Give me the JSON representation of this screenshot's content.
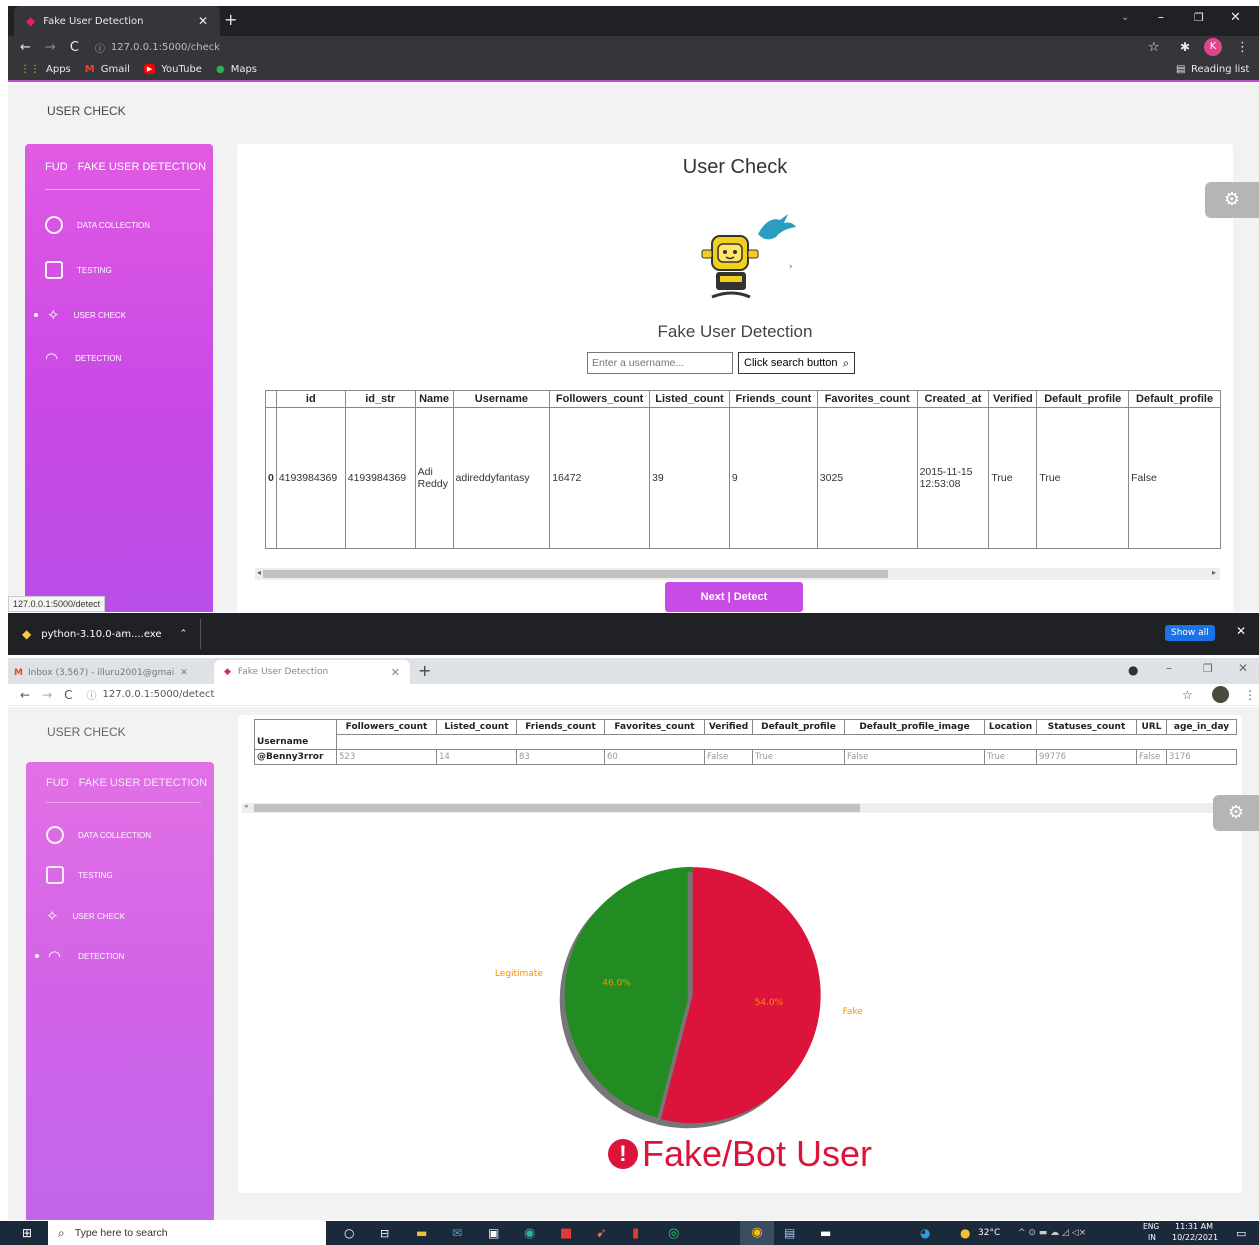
{
  "browser_top": {
    "tab_title": "Fake User Detection",
    "url": "127.0.0.1:5000/check",
    "bookmarks": [
      "Apps",
      "Gmail",
      "YouTube",
      "Maps"
    ],
    "reading_list": "Reading list",
    "profile_initial": "K"
  },
  "page_check": {
    "header": "USER CHECK",
    "sidebar": {
      "brand_short": "FUD",
      "brand_full": "FAKE USER DETECTION",
      "items": [
        "DATA COLLECTION",
        "TESTING",
        "USER CHECK",
        "DETECTION"
      ],
      "active": "USER CHECK"
    },
    "title": "User Check",
    "subtitle": "Fake User Detection",
    "search_placeholder": "Enter a username...",
    "search_button": "Click search button",
    "table": {
      "columns": [
        "",
        "id",
        "id_str",
        "Name",
        "Username",
        "Followers_count",
        "Listed_count",
        "Friends_count",
        "Favorites_count",
        "Created_at",
        "Verified",
        "Default_profile",
        "Default_profile"
      ],
      "row": [
        "0",
        "4193984369",
        "4193984369",
        "Adi Reddy",
        "adireddyfantasy",
        "16472",
        "39",
        "9",
        "3025",
        "2015-11-15 12:53:08",
        "True",
        "True",
        "False"
      ]
    },
    "next_button": "Next | Detect",
    "status_url": "127.0.0.1:5000/detect"
  },
  "download_bar": {
    "file": "python-3.10.0-am....exe",
    "show_all": "Show all"
  },
  "browser_bottom": {
    "tab1": "Inbox (3,567) - illuru2001@gmai",
    "tab2": "Fake User Detection",
    "url": "127.0.0.1:5000/detect"
  },
  "page_detect": {
    "header": "USER CHECK",
    "sidebar": {
      "brand_short": "FUD",
      "brand_full": "FAKE USER DETECTION",
      "items": [
        "DATA COLLECTION",
        "TESTING",
        "USER CHECK",
        "DETECTION"
      ],
      "active": "DETECTION"
    },
    "table": {
      "columns": [
        "Followers_count",
        "Listed_count",
        "Friends_count",
        "Favorites_count",
        "Verified",
        "Default_profile",
        "Default_profile_image",
        "Location",
        "Statuses_count",
        "URL",
        "age_in_day"
      ],
      "index_label": "Username",
      "row_label": "@Benny3rror",
      "row": [
        "523",
        "14",
        "83",
        "60",
        "False",
        "True",
        "False",
        "True",
        "99776",
        "False",
        "3176"
      ]
    },
    "result": "Fake/Bot User"
  },
  "chart_data": {
    "type": "pie",
    "labels": [
      "Legitimate",
      "Fake"
    ],
    "values": [
      46.0,
      54.0
    ],
    "value_labels": [
      "46.0%",
      "54.0%"
    ],
    "colors": [
      "#228b22",
      "#dc143c"
    ],
    "explode": [
      0,
      0.1
    ],
    "title": ""
  },
  "taskbar": {
    "search_placeholder": "Type here to search",
    "temperature": "32°C",
    "lang": "ENG",
    "region": "IN",
    "time": "11:31 AM",
    "date": "10/22/2021"
  }
}
